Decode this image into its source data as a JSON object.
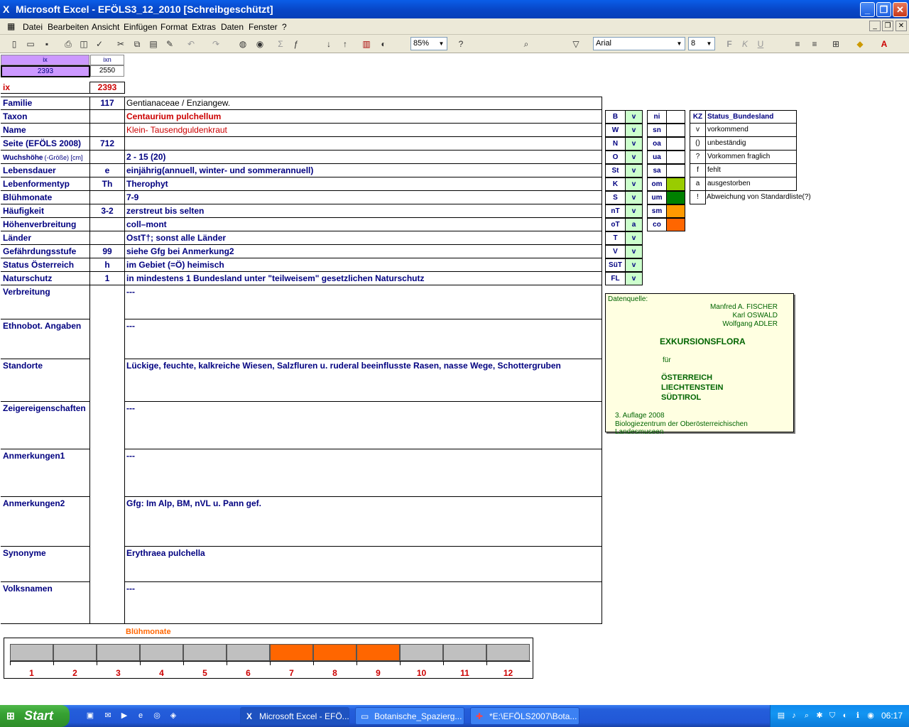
{
  "window": {
    "title": "Microsoft Excel - EFÖLS3_12_2010  [Schreibgeschützt]"
  },
  "menu": [
    "Datei",
    "Bearbeiten",
    "Ansicht",
    "Einfügen",
    "Format",
    "Extras",
    "Daten",
    "Fenster",
    "?"
  ],
  "toolbar": {
    "zoom": "85%",
    "font": "Arial",
    "font_size": "8"
  },
  "header_cells": {
    "ix_head": "ix",
    "ixn_head": "ixn",
    "ix_val": "2393",
    "ixn_val": "2550",
    "ix_label": "ix",
    "ix_red": "2393"
  },
  "rows": [
    {
      "label": "Familie",
      "code": "117",
      "value": "Gentianaceae  /  Enziangew."
    },
    {
      "label": "Taxon",
      "code": "",
      "value": "Centaurium pulchellum"
    },
    {
      "label": "Name",
      "code": "",
      "value": "Klein- Tausendguldenkraut"
    },
    {
      "label": "Seite (EFÖLS 2008)",
      "code": "712",
      "value": ""
    },
    {
      "label": "Wuchshöhe",
      "label_small": "(-Größe) [cm]",
      "code": "",
      "value": " 2 - 15 (20)"
    },
    {
      "label": "Lebensdauer",
      "code": "e",
      "value": "einjährig(annuell, winter- und sommerannuell)"
    },
    {
      "label": "Lebenformentyp",
      "code": "Th",
      "value": "Therophyt"
    },
    {
      "label": "Blühmonate",
      "code": "",
      "value": " 7-9"
    },
    {
      "label": "Häufigkeit",
      "code": "3-2",
      "value": "zerstreut bis selten"
    },
    {
      "label": "Höhenverbreitung",
      "code": "",
      "value": "coll–mont"
    },
    {
      "label": "Länder",
      "code": "",
      "value": " OstT†; sonst alle Länder"
    },
    {
      "label": "Gefährdungsstufe",
      "code": "99",
      "value": "siehe Gfg bei Anmerkung2"
    },
    {
      "label": "Status Österreich",
      "code": "h",
      "value": "im Gebiet (=Ö) heimisch"
    },
    {
      "label": "Naturschutz",
      "code": "1",
      "value": "in mindestens 1 Bundesland unter \"teilweisem\" gesetzlichen Naturschutz"
    }
  ],
  "big_rows": [
    {
      "label": "Verbreitung",
      "value": " ---"
    },
    {
      "label": "Ethnobot. Angaben",
      "value": "---"
    },
    {
      "label": "Standorte",
      "value": "Lückige, feuchte, kalkreiche Wiesen, Salzfluren u. ruderal beeinflusste Rasen, nasse Wege, Schottergruben"
    },
    {
      "label": "Zeigereigenschaften",
      "value": "---"
    },
    {
      "label": "Anmerkungen1",
      "value": "---"
    },
    {
      "label": "Anmerkungen2",
      "value": "Gfg: Im Alp, BM, nVL u. Pann gef."
    },
    {
      "label": "Synonyme",
      "value": "Erythraea pulchella"
    },
    {
      "label": "Volksnamen",
      "value": "---"
    }
  ],
  "states": [
    {
      "code": "B",
      "val": "v"
    },
    {
      "code": "W",
      "val": "v"
    },
    {
      "code": "N",
      "val": "v"
    },
    {
      "code": "O",
      "val": "v"
    },
    {
      "code": "St",
      "val": "v"
    },
    {
      "code": "K",
      "val": "v"
    },
    {
      "code": "S",
      "val": "v"
    },
    {
      "code": "nT",
      "val": "v"
    },
    {
      "code": "oT",
      "val": "a"
    },
    {
      "code": "T",
      "val": "v"
    },
    {
      "code": "V",
      "val": "v"
    },
    {
      "code": "SüT",
      "val": "v"
    },
    {
      "code": "FL",
      "val": "v"
    }
  ],
  "altitudes": [
    {
      "code": "ni",
      "color": "#ffffff"
    },
    {
      "code": "sn",
      "color": "#ffffff"
    },
    {
      "code": "oa",
      "color": "#ffffff"
    },
    {
      "code": "ua",
      "color": "#ffffff"
    },
    {
      "code": "sa",
      "color": "#ffffff"
    },
    {
      "code": "om",
      "color": "#99cc00"
    },
    {
      "code": "um",
      "color": "#008000"
    },
    {
      "code": "sm",
      "color": "#ff9900"
    },
    {
      "code": "co",
      "color": "#ff6600"
    }
  ],
  "status_legend": {
    "head_kz": "KZ",
    "head_status": "Status_Bundesland",
    "items": [
      {
        "kz": "v",
        "text": "vorkommend"
      },
      {
        "kz": "()",
        "text": "unbeständig"
      },
      {
        "kz": "?",
        "text": "Vorkommen fraglich"
      },
      {
        "kz": "f",
        "text": "fehlt"
      },
      {
        "kz": "a",
        "text": "ausgestorben"
      },
      {
        "kz": "!",
        "text": "Abweichung von Standardliste(?)"
      }
    ]
  },
  "source": {
    "label": "Datenquelle:",
    "authors": [
      "Manfred A. FISCHER",
      "Karl OSWALD",
      "Wolfgang ADLER"
    ],
    "title": "EXKURSIONSFLORA",
    "fuer": "für",
    "regions": [
      "ÖSTERREICH",
      "LIECHTENSTEIN",
      "SÜDTIROL"
    ],
    "edition": "3. Auflage 2008",
    "publisher": "Biologiezentrum der Oberösterreichischen Landesmuseen"
  },
  "bloom": {
    "title": "Blühmonate",
    "months": [
      "1",
      "2",
      "3",
      "4",
      "5",
      "6",
      "7",
      "8",
      "9",
      "10",
      "11",
      "12"
    ],
    "active": [
      false,
      false,
      false,
      false,
      false,
      false,
      true,
      true,
      true,
      false,
      false,
      false
    ],
    "active_color": "#ff6600",
    "inactive_color": "#c0c0c0"
  },
  "taskbar": {
    "start": "Start",
    "tasks": [
      "Microsoft Excel - EFÖ...",
      "Botanische_Spazierg...",
      "*E:\\EFÖLS2007\\Bota..."
    ],
    "clock": "06:17"
  }
}
